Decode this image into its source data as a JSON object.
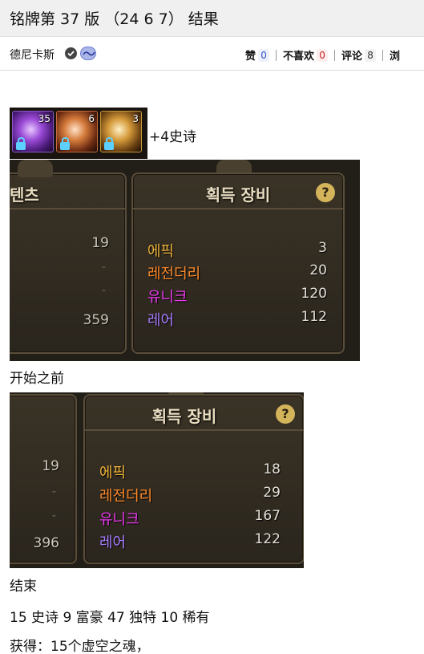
{
  "page": {
    "title": "铭牌第 37 版 （24 6 7） 结果"
  },
  "meta": {
    "author": "德尼卡斯",
    "stats": [
      {
        "label": "赞",
        "value": "0"
      },
      {
        "label": "不喜欢",
        "value": "0"
      },
      {
        "label": "评论",
        "value": "8"
      },
      {
        "label": "浏",
        "value": ""
      }
    ]
  },
  "post": {
    "strip": {
      "counts": [
        "35",
        "6",
        "3"
      ],
      "caption": "+4史诗"
    },
    "before": {
      "left_tab_title": "텐츠",
      "left_values": [
        "19",
        "-",
        "-",
        "359"
      ],
      "panel_title": "획득 장비",
      "help": "?",
      "rows": [
        {
          "grade": "에픽",
          "value": "3"
        },
        {
          "grade": "레전더리",
          "value": "20"
        },
        {
          "grade": "유니크",
          "value": "120"
        },
        {
          "grade": "레어",
          "value": "112"
        }
      ],
      "caption": "开始之前"
    },
    "after": {
      "left_values": [
        "19",
        "-",
        "-",
        "396"
      ],
      "panel_title": "획득 장비",
      "help": "?",
      "rows": [
        {
          "grade": "에픽",
          "value": "18"
        },
        {
          "grade": "레전더리",
          "value": "29"
        },
        {
          "grade": "유니크",
          "value": "167"
        },
        {
          "grade": "레어",
          "value": "122"
        }
      ],
      "caption": "结束"
    },
    "summary": "15 史诗 9 富豪 47 独特 10 稀有",
    "obtained": "获得：15个虚空之魂，"
  },
  "colors": {
    "epic": "#f0b43a",
    "legendary": "#ff8a2a",
    "unique": "#ee3af0",
    "rare": "#a87cff"
  }
}
